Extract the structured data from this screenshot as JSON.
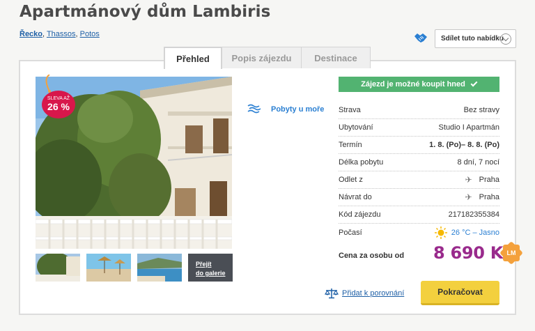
{
  "title": "Apartmánový dům Lambiris",
  "breadcrumb": [
    "Řecko",
    "Thassos",
    "Potos"
  ],
  "share": {
    "label": "Sdílet tuto nabídku"
  },
  "tabs": [
    {
      "label": "Přehled",
      "active": true
    },
    {
      "label": "Popis zájezdu",
      "active": false
    },
    {
      "label": "Destinace",
      "active": false
    }
  ],
  "discount": {
    "text": "SLEVA AŽ",
    "value": "26 %",
    "color": "#d8174b"
  },
  "gallery": {
    "link_line1": "Přejít",
    "link_line2": "do galerie"
  },
  "feature": {
    "icon": "beach-icon",
    "label": "Pobyty u moře"
  },
  "availability": {
    "label": "Zájezd je možné koupit hned",
    "color": "#52b371"
  },
  "info": [
    {
      "label": "Strava",
      "value": "Bez stravy"
    },
    {
      "label": "Ubytování",
      "value": "Studio I Apartmán"
    },
    {
      "label": "Termín",
      "value": "1. 8. (Po)– 8. 8. (Po)"
    },
    {
      "label": "Délka pobytu",
      "value": "8 dní, 7 nocí"
    },
    {
      "label": "Odlet z",
      "value": "Praha",
      "icon": "plane-icon"
    },
    {
      "label": "Návrat do",
      "value": "Praha",
      "icon": "plane-icon"
    },
    {
      "label": "Kód zájezdu",
      "value": "217182355384"
    },
    {
      "label": "Počasí",
      "value": "26 °C – Jasno",
      "icon": "sun-icon"
    }
  ],
  "price": {
    "label": "Cena za osobu od",
    "value": "8 690 Kč",
    "badge": "LM",
    "color": "#992a8c"
  },
  "compare": {
    "label": "Přidat k porovnání"
  },
  "continue": {
    "label": "Pokračovat",
    "color": "#f3d03e"
  }
}
